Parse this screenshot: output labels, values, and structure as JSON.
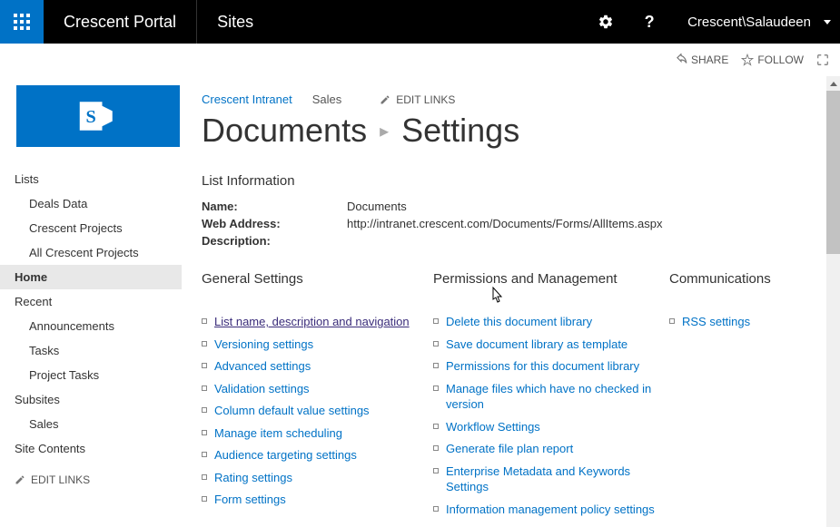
{
  "topbar": {
    "site_title": "Crescent Portal",
    "nav_label": "Sites",
    "user": "Crescent\\Salaudeen"
  },
  "socialbar": {
    "share": "SHARE",
    "follow": "FOLLOW"
  },
  "breadcrumb": {
    "root": "Crescent Intranet",
    "node": "Sales",
    "edit_links": "EDIT LINKS"
  },
  "page_title": {
    "library": "Documents",
    "page": "Settings"
  },
  "list_info": {
    "heading": "List Information",
    "name_label": "Name:",
    "name_value": "Documents",
    "web_label": "Web Address:",
    "web_value": "http://intranet.crescent.com/Documents/Forms/AllItems.aspx",
    "desc_label": "Description:",
    "desc_value": ""
  },
  "columns": {
    "general": {
      "heading": "General Settings",
      "links": [
        "List name, description and navigation",
        "Versioning settings",
        "Advanced settings",
        "Validation settings",
        "Column default value settings",
        "Manage item scheduling",
        "Audience targeting settings",
        "Rating settings",
        "Form settings"
      ]
    },
    "perms": {
      "heading": "Permissions and Management",
      "links": [
        "Delete this document library",
        "Save document library as template",
        "Permissions for this document library",
        "Manage files which have no checked in version",
        "Workflow Settings",
        "Generate file plan report",
        "Enterprise Metadata and Keywords Settings",
        "Information management policy settings"
      ]
    },
    "comms": {
      "heading": "Communications",
      "links": [
        "RSS settings"
      ]
    }
  },
  "sidebar": {
    "lists_heading": "Lists",
    "lists": [
      "Deals Data",
      "Crescent Projects",
      "All Crescent Projects"
    ],
    "home": "Home",
    "recent_heading": "Recent",
    "recent": [
      "Announcements",
      "Tasks",
      "Project Tasks"
    ],
    "subsites_heading": "Subsites",
    "subsites": [
      "Sales"
    ],
    "site_contents": "Site Contents",
    "edit_links": "EDIT LINKS"
  }
}
